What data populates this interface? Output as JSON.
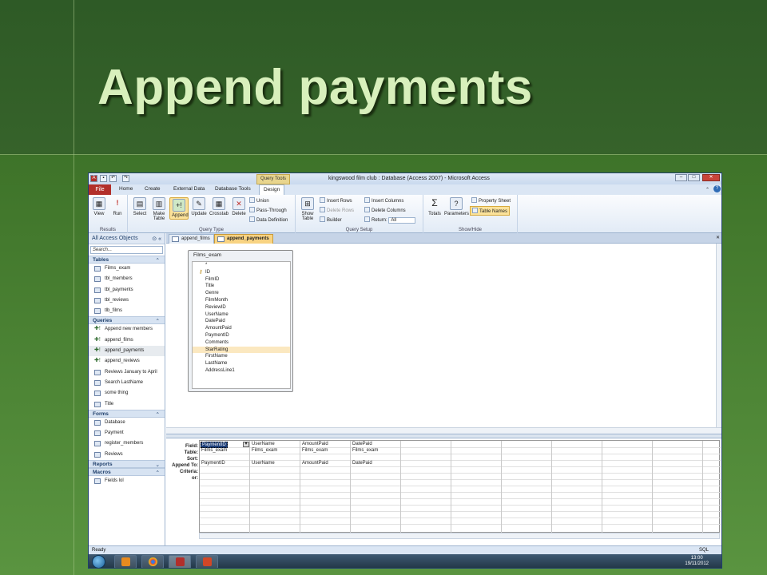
{
  "slide": {
    "title": "Append payments"
  },
  "window": {
    "app_title": "kingswood film club : Database (Access 2007) - Microsoft Access",
    "contextual_tab": "Query Tools",
    "tabs": [
      "File",
      "Home",
      "Create",
      "External Data",
      "Database Tools",
      "Design"
    ],
    "active_tab": "Design"
  },
  "ribbon": {
    "results": {
      "label": "Results",
      "view": "View",
      "run": "Run"
    },
    "query_type": {
      "label": "Query Type",
      "select": "Select",
      "make_table": "Make Table",
      "append": "Append",
      "update": "Update",
      "crosstab": "Crosstab",
      "delete": "Delete",
      "union": "Union",
      "pass_through": "Pass-Through",
      "data_definition": "Data Definition"
    },
    "query_setup": {
      "label": "Query Setup",
      "show_table": "Show Table",
      "insert_rows": "Insert Rows",
      "delete_rows": "Delete Rows",
      "builder": "Builder",
      "insert_columns": "Insert Columns",
      "delete_columns": "Delete Columns",
      "return_label": "Return:",
      "return_value": "All"
    },
    "show_hide": {
      "label": "Show/Hide",
      "totals": "Totals",
      "parameters": "Parameters",
      "property_sheet": "Property Sheet",
      "table_names": "Table Names"
    }
  },
  "nav": {
    "header": "All Access Objects",
    "search_placeholder": "Search...",
    "tables_label": "Tables",
    "tables": [
      "Films_exam",
      "tbl_members",
      "tbl_payments",
      "tbl_reviews",
      "tlb_films"
    ],
    "queries_label": "Queries",
    "queries": [
      "Append new members",
      "append_films",
      "append_payments",
      "append_reviews",
      "Reviews January to April",
      "Search LastName",
      "some thing",
      "Title"
    ],
    "forms_label": "Forms",
    "forms": [
      "Database",
      "Payment",
      "register_members",
      "Reviews"
    ],
    "reports_label": "Reports",
    "macros_label": "Macros",
    "macros": [
      "Fields lol"
    ]
  },
  "doc_tabs": [
    "append_films",
    "append_payments"
  ],
  "field_list": {
    "table_name": "Films_exam",
    "fields": [
      "*",
      "ID",
      "FilmID",
      "Title",
      "Genre",
      "FilmMonth",
      "ReviewID",
      "UserName",
      "DatePaid",
      "AmountPaid",
      "PaymentID",
      "Comments",
      "StarRating",
      "FirstName",
      "LastName",
      "AddressLine1"
    ],
    "highlighted": "StarRating"
  },
  "grid": {
    "row_labels": [
      "Field:",
      "Table:",
      "Sort:",
      "Append To:",
      "Criteria:",
      "or:"
    ],
    "columns": [
      {
        "field": "PaymentID",
        "table": "Films_exam",
        "append_to": "PaymentID"
      },
      {
        "field": "UserName",
        "table": "Films_exam",
        "append_to": "UserName"
      },
      {
        "field": "AmountPaid",
        "table": "Films_exam",
        "append_to": "AmountPaid"
      },
      {
        "field": "DatePaid",
        "table": "Films_exam",
        "append_to": "DatePaid"
      }
    ]
  },
  "status": {
    "text": "Ready",
    "mode": "SQL"
  },
  "clock": {
    "time": "13:00",
    "date": "19/11/2012"
  }
}
